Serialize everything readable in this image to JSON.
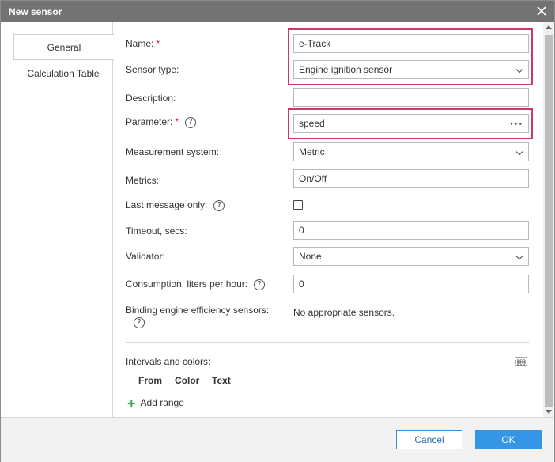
{
  "window": {
    "title": "New sensor"
  },
  "tabs": [
    {
      "label": "General"
    },
    {
      "label": "Calculation Table"
    }
  ],
  "form": {
    "name": {
      "label": "Name:",
      "required_mark": "*",
      "value": "e-Track"
    },
    "sensor_type": {
      "label": "Sensor type:",
      "value": "Engine ignition sensor"
    },
    "description": {
      "label": "Description:",
      "value": ""
    },
    "parameter": {
      "label": "Parameter:",
      "required_mark": "*",
      "help": "?",
      "value": "speed",
      "more": "···"
    },
    "measurement_system": {
      "label": "Measurement system:",
      "value": "Metric"
    },
    "metrics": {
      "label": "Metrics:",
      "value": "On/Off"
    },
    "last_message_only": {
      "label": "Last message only:",
      "help": "?",
      "checked": false
    },
    "timeout": {
      "label": "Timeout, secs:",
      "value": "0"
    },
    "validator": {
      "label": "Validator:",
      "value": "None"
    },
    "consumption": {
      "label": "Consumption, liters per hour:",
      "help": "?",
      "value": "0"
    },
    "binding": {
      "label": "Binding engine efficiency sensors:",
      "help": "?",
      "value": "No appropriate sensors."
    },
    "intervals": {
      "label": "Intervals and colors:",
      "columns": [
        "From",
        "Color",
        "Text"
      ],
      "add_range": "Add range"
    }
  },
  "footer": {
    "cancel_label": "Cancel",
    "ok_label": "OK"
  },
  "colors": {
    "highlight": "#d6336c",
    "accent": "#3596e6",
    "required": "#e0194a",
    "add": "#3aa757"
  }
}
